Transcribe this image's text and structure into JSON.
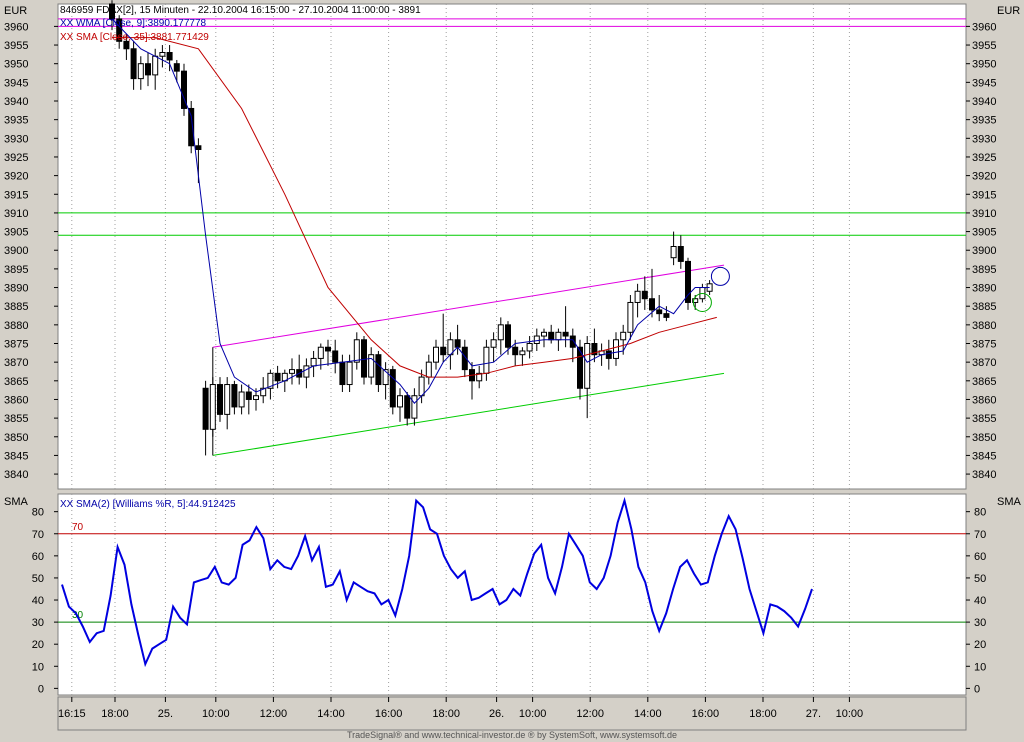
{
  "chart_data": [
    {
      "type": "candlestick",
      "instrument_line": "846959  FDAX[2], 15 Minuten - 22.10.2004 16:15:00 - 27.10.2004 11:00:00 - 3891",
      "currency_left": "EUR",
      "currency_right": "EUR",
      "ylim": [
        3836,
        3966
      ],
      "yticks": [
        3840,
        3845,
        3850,
        3855,
        3860,
        3865,
        3870,
        3875,
        3880,
        3885,
        3890,
        3895,
        3900,
        3905,
        3910,
        3915,
        3920,
        3925,
        3930,
        3935,
        3940,
        3945,
        3950,
        3955,
        3960
      ],
      "legend": [
        {
          "prefix": "XX",
          "text": "WMA [Close, 9]:3890.177778",
          "color": "#0000a8"
        },
        {
          "prefix": "XX",
          "text": "SMA [Close, 35]:3881.771429",
          "color": "#c00000"
        }
      ],
      "candles": [
        [
          3966,
          3967,
          3959,
          3962
        ],
        [
          3962,
          3963,
          3954,
          3956
        ],
        [
          3956,
          3958,
          3951,
          3954
        ],
        [
          3954,
          3956,
          3943,
          3946
        ],
        [
          3946,
          3952,
          3943,
          3950
        ],
        [
          3950,
          3953,
          3944,
          3947
        ],
        [
          3947,
          3954,
          3943,
          3952
        ],
        [
          3952,
          3955,
          3949,
          3953
        ],
        [
          3953,
          3955,
          3948,
          3951
        ],
        [
          3950,
          3951,
          3945,
          3948
        ],
        [
          3948,
          3950,
          3936,
          3938
        ],
        [
          3938,
          3940,
          3926,
          3928
        ],
        [
          3928,
          3930,
          3918,
          3927
        ],
        [
          3863,
          3865,
          3845,
          3852
        ],
        [
          3852,
          3866,
          3850,
          3864
        ],
        [
          3864,
          3866,
          3854,
          3856
        ],
        [
          3856,
          3866,
          3852,
          3864
        ],
        [
          3864,
          3865,
          3856,
          3858
        ],
        [
          3858,
          3864,
          3856,
          3862
        ],
        [
          3862,
          3864,
          3856,
          3860
        ],
        [
          3860,
          3863,
          3857,
          3861
        ],
        [
          3861,
          3866,
          3859,
          3863
        ],
        [
          3863,
          3868,
          3860,
          3867
        ],
        [
          3867,
          3869,
          3863,
          3865
        ],
        [
          3865,
          3868,
          3862,
          3867
        ],
        [
          3867,
          3871,
          3864,
          3868
        ],
        [
          3868,
          3872,
          3864,
          3866
        ],
        [
          3866,
          3871,
          3863,
          3869
        ],
        [
          3869,
          3873,
          3866,
          3871
        ],
        [
          3871,
          3875,
          3868,
          3874
        ],
        [
          3874,
          3876,
          3869,
          3873
        ],
        [
          3873,
          3876,
          3867,
          3870
        ],
        [
          3870,
          3872,
          3862,
          3864
        ],
        [
          3864,
          3872,
          3862,
          3870
        ],
        [
          3870,
          3878,
          3868,
          3876
        ],
        [
          3876,
          3877,
          3864,
          3866
        ],
        [
          3866,
          3874,
          3864,
          3872
        ],
        [
          3872,
          3873,
          3862,
          3864
        ],
        [
          3864,
          3870,
          3860,
          3868
        ],
        [
          3868,
          3869,
          3856,
          3858
        ],
        [
          3858,
          3863,
          3854,
          3861
        ],
        [
          3861,
          3862,
          3853,
          3855
        ],
        [
          3855,
          3863,
          3853,
          3861
        ],
        [
          3861,
          3868,
          3859,
          3866
        ],
        [
          3866,
          3872,
          3864,
          3870
        ],
        [
          3870,
          3876,
          3868,
          3874
        ],
        [
          3874,
          3883,
          3870,
          3872
        ],
        [
          3872,
          3878,
          3868,
          3876
        ],
        [
          3876,
          3880,
          3872,
          3874
        ],
        [
          3874,
          3876,
          3866,
          3868
        ],
        [
          3868,
          3870,
          3860,
          3865
        ],
        [
          3865,
          3869,
          3863,
          3867
        ],
        [
          3867,
          3876,
          3865,
          3874
        ],
        [
          3874,
          3878,
          3870,
          3876
        ],
        [
          3876,
          3882,
          3872,
          3880
        ],
        [
          3880,
          3881,
          3872,
          3874
        ],
        [
          3874,
          3876,
          3869,
          3872
        ],
        [
          3872,
          3874,
          3869,
          3873
        ],
        [
          3873,
          3877,
          3871,
          3875
        ],
        [
          3875,
          3879,
          3873,
          3877
        ],
        [
          3877,
          3879,
          3874,
          3878
        ],
        [
          3878,
          3880,
          3875,
          3876
        ],
        [
          3876,
          3879,
          3873,
          3878
        ],
        [
          3878,
          3885,
          3874,
          3877
        ],
        [
          3877,
          3879,
          3870,
          3874
        ],
        [
          3874,
          3876,
          3860,
          3863
        ],
        [
          3863,
          3877,
          3855,
          3875
        ],
        [
          3875,
          3879,
          3870,
          3872
        ],
        [
          3872,
          3875,
          3869,
          3873
        ],
        [
          3873,
          3876,
          3868,
          3871
        ],
        [
          3871,
          3878,
          3869,
          3876
        ],
        [
          3876,
          3880,
          3872,
          3878
        ],
        [
          3878,
          3888,
          3876,
          3886
        ],
        [
          3886,
          3891,
          3882,
          3889
        ],
        [
          3889,
          3893,
          3884,
          3887
        ],
        [
          3887,
          3895,
          3882,
          3884
        ],
        [
          3884,
          3888,
          3881,
          3883
        ],
        [
          3883,
          3885,
          3881,
          3882
        ],
        [
          3898,
          3905,
          3896,
          3901
        ],
        [
          3901,
          3904,
          3895,
          3897
        ],
        [
          3897,
          3898,
          3884,
          3886
        ],
        [
          3886,
          3888,
          3884,
          3887
        ],
        [
          3887,
          3891,
          3886,
          3890
        ],
        [
          3889,
          3892,
          3888,
          3891
        ]
      ],
      "sma35": [
        [
          0,
          3957
        ],
        [
          6,
          3957
        ],
        [
          12,
          3954
        ],
        [
          18,
          3938
        ],
        [
          24,
          3915
        ],
        [
          30,
          3890
        ],
        [
          36,
          3876
        ],
        [
          40,
          3869
        ],
        [
          44,
          3866
        ],
        [
          48,
          3866
        ],
        [
          52,
          3867
        ],
        [
          56,
          3869
        ],
        [
          60,
          3870
        ],
        [
          64,
          3871
        ],
        [
          68,
          3873
        ],
        [
          72,
          3875
        ],
        [
          76,
          3878
        ],
        [
          80,
          3880
        ],
        [
          84,
          3882
        ]
      ],
      "wma9": [
        [
          0,
          3962
        ],
        [
          4,
          3954
        ],
        [
          8,
          3950
        ],
        [
          11,
          3936
        ],
        [
          13,
          3904
        ],
        [
          15,
          3875
        ],
        [
          17,
          3866
        ],
        [
          20,
          3862
        ],
        [
          24,
          3865
        ],
        [
          28,
          3869
        ],
        [
          32,
          3870
        ],
        [
          36,
          3871
        ],
        [
          40,
          3864
        ],
        [
          42,
          3859
        ],
        [
          44,
          3863
        ],
        [
          46,
          3870
        ],
        [
          48,
          3874
        ],
        [
          50,
          3869
        ],
        [
          53,
          3870
        ],
        [
          56,
          3875
        ],
        [
          60,
          3876
        ],
        [
          64,
          3876
        ],
        [
          66,
          3870
        ],
        [
          68,
          3872
        ],
        [
          71,
          3873
        ],
        [
          73,
          3880
        ],
        [
          76,
          3885
        ],
        [
          78,
          3883
        ],
        [
          80,
          3888
        ],
        [
          81,
          3890
        ],
        [
          83,
          3890
        ]
      ],
      "channel_upper": [
        [
          14,
          3874
        ],
        [
          85,
          3896
        ]
      ],
      "channel_lower": [
        [
          14,
          3845
        ],
        [
          85,
          3867
        ]
      ],
      "hlines": [
        {
          "y": 3960,
          "color": "#e000e0"
        },
        {
          "y": 3962,
          "color": "#e000e0"
        },
        {
          "y": 3910,
          "color": "#00cc00"
        },
        {
          "y": 3904,
          "color": "#00cc00"
        }
      ],
      "circles": [
        {
          "i": 82,
          "y": 3886,
          "color": "#00aa00"
        },
        {
          "i": 84.5,
          "y": 3893,
          "color": "#0000a8"
        }
      ]
    },
    {
      "type": "line",
      "name_left": "SMA",
      "name_right": "SMA",
      "legend": {
        "prefix": "XX",
        "text": "SMA(2) [Williams %R, 5]:44.912425",
        "color": "#0000a8"
      },
      "ylim": [
        -3,
        88
      ],
      "yticks": [
        0,
        10,
        20,
        30,
        40,
        50,
        60,
        70,
        80
      ],
      "levels": [
        {
          "value": 70,
          "label": "70",
          "color": "#c00000"
        },
        {
          "value": 30,
          "label": "30",
          "color": "#008000"
        }
      ],
      "values": [
        47,
        37,
        34,
        28,
        21,
        25,
        26,
        42,
        64,
        56,
        38,
        24,
        11,
        18,
        20,
        22,
        37,
        32,
        29,
        48,
        49,
        50,
        55,
        48,
        47,
        50,
        65,
        67,
        73,
        68,
        54,
        58,
        55,
        54,
        60,
        69,
        58,
        64,
        46,
        47,
        53,
        40,
        48,
        46,
        44,
        43,
        38,
        40,
        33,
        45,
        60,
        85,
        82,
        72,
        70,
        60,
        54,
        50,
        53,
        40,
        41,
        43,
        45,
        38,
        40,
        45,
        42,
        52,
        61,
        65,
        50,
        43,
        55,
        70,
        65,
        60,
        48,
        45,
        50,
        60,
        75,
        85,
        72,
        55,
        48,
        35,
        26,
        34,
        45,
        55,
        58,
        52,
        47,
        48,
        60,
        70,
        78,
        72,
        59,
        45,
        35,
        25,
        38,
        37,
        35,
        32,
        28,
        36,
        45
      ]
    }
  ],
  "x_axis": {
    "labels": [
      {
        "i": -6,
        "text": "16:15"
      },
      {
        "i": 0,
        "text": "18:00"
      },
      {
        "i": 7,
        "text": "25."
      },
      {
        "i": 14,
        "text": "10:00"
      },
      {
        "i": 22,
        "text": "12:00"
      },
      {
        "i": 30,
        "text": "14:00"
      },
      {
        "i": 38,
        "text": "16:00"
      },
      {
        "i": 46,
        "text": "18:00"
      },
      {
        "i": 53,
        "text": "26."
      },
      {
        "i": 58,
        "text": "10:00"
      },
      {
        "i": 66,
        "text": "12:00"
      },
      {
        "i": 74,
        "text": "14:00"
      },
      {
        "i": 82,
        "text": "16:00"
      },
      {
        "i": 90,
        "text": "18:00"
      },
      {
        "i": 97,
        "text": "27."
      },
      {
        "i": 102,
        "text": "10:00"
      }
    ]
  },
  "footer": "TradeSignal® and www.technical-investor.de ® by SystemSoft, www.systemsoft.de"
}
